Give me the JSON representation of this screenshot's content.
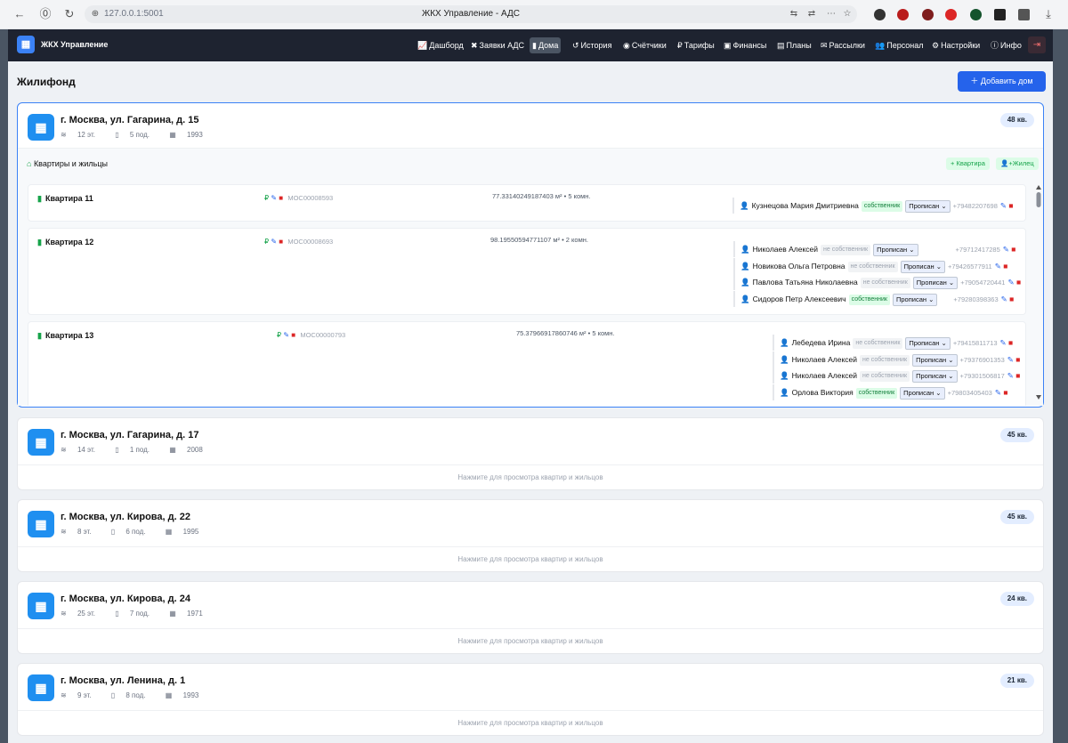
{
  "browser": {
    "url": "127.0.0.1:5001",
    "title": "ЖКХ Управление - АДС"
  },
  "app": {
    "brand": "ЖКХ Управление"
  },
  "nav": [
    {
      "label": "Дашборд",
      "icon": "chart-icon"
    },
    {
      "label": "Заявки АДС",
      "icon": "tools-icon"
    },
    {
      "label": "Дома",
      "icon": "building-icon",
      "active": true
    },
    {
      "label": "История",
      "icon": "history-icon"
    },
    {
      "label": "Счётчики",
      "icon": "meter-icon"
    },
    {
      "label": "Тарифы",
      "icon": "ruble-icon"
    },
    {
      "label": "Финансы",
      "icon": "money-icon"
    },
    {
      "label": "Планы",
      "icon": "calendar-icon"
    },
    {
      "label": "Рассылки",
      "icon": "mail-icon"
    },
    {
      "label": "Персонал",
      "icon": "users-icon"
    },
    {
      "label": "Настройки",
      "icon": "gear-icon"
    },
    {
      "label": "Инфо",
      "icon": "info-icon"
    }
  ],
  "page": {
    "title": "Жилифонд",
    "add_button": "Добавить дом"
  },
  "section": {
    "title": "Квартиры и жильцы",
    "add_flat": "Квартира",
    "add_resident": "Жилец"
  },
  "hint": "Нажмите для просмотра квартир и жильцов",
  "houses": [
    {
      "address": "г. Москва, ул. Гагарина, д. 15",
      "floors": "12 эт.",
      "entrances": "5 под.",
      "year": "1993",
      "flats": "48 кв."
    },
    {
      "address": "г. Москва, ул. Гагарина, д. 17",
      "floors": "14 эт.",
      "entrances": "1 под.",
      "year": "2008",
      "flats": "45 кв."
    },
    {
      "address": "г. Москва, ул. Кирова, д. 22",
      "floors": "8 эт.",
      "entrances": "6 под.",
      "year": "1995",
      "flats": "45 кв."
    },
    {
      "address": "г. Москва, ул. Кирова, д. 24",
      "floors": "25 эт.",
      "entrances": "7 под.",
      "year": "1971",
      "flats": "24 кв."
    },
    {
      "address": "г. Москва, ул. Ленина, д. 1",
      "floors": "9 эт.",
      "entrances": "8 под.",
      "year": "1993",
      "flats": "21 кв."
    }
  ],
  "apartments": [
    {
      "name": "Квартира 11",
      "code": "МОС00008593",
      "info": "77.33140249187403 м² • 5 комн.",
      "residents": [
        {
          "name": "Кузнецова Мария Дмитриевна",
          "role": "собственник",
          "owner": true,
          "status": "Прописан",
          "phone": "+79482207698"
        }
      ]
    },
    {
      "name": "Квартира 12",
      "code": "МОС00008693",
      "info": "98.19550594771107 м² • 2 комн.",
      "residents": [
        {
          "name": "Николаев Алексей",
          "role": "не собственник",
          "owner": false,
          "status": "Прописан",
          "phone": "+79712417285"
        },
        {
          "name": "Новикова Ольга Петровна",
          "role": "не собственник",
          "owner": false,
          "status": "Прописан",
          "phone": "+79426577911"
        },
        {
          "name": "Павлова Татьяна Николаевна",
          "role": "не собственник",
          "owner": false,
          "status": "Прописан",
          "phone": "+79054720441"
        },
        {
          "name": "Сидоров Петр Алексеевич",
          "role": "собственник",
          "owner": true,
          "status": "Прописан",
          "phone": "+79280398363"
        }
      ]
    },
    {
      "name": "Квартира 13",
      "code": "МОС00000793",
      "info": "75.37966917860746 м² • 5 комн.",
      "residents": [
        {
          "name": "Лебедева Ирина",
          "role": "не собственник",
          "owner": false,
          "status": "Прописан",
          "phone": "+79415811713"
        },
        {
          "name": "Николаев Алексей",
          "role": "не собственник",
          "owner": false,
          "status": "Прописан",
          "phone": "+79376901353"
        },
        {
          "name": "Николаев Алексей",
          "role": "не собственник",
          "owner": false,
          "status": "Прописан",
          "phone": "+79301506817"
        },
        {
          "name": "Орлова Виктория",
          "role": "собственник",
          "owner": true,
          "status": "Прописан",
          "phone": "+79803405403"
        }
      ]
    }
  ]
}
